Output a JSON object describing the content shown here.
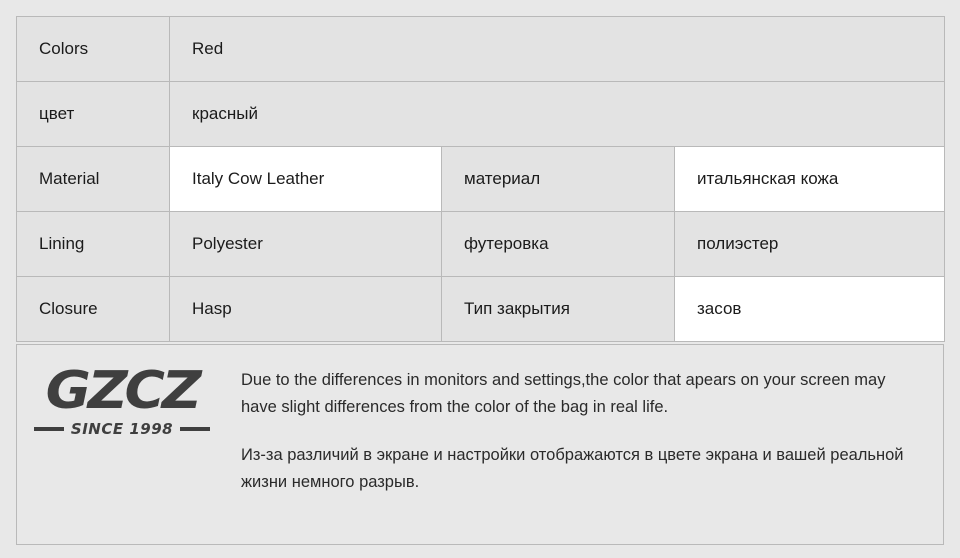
{
  "spec_table": {
    "rows": [
      {
        "name": "colors-en",
        "cells": [
          {
            "text": "Colors",
            "white": false,
            "span": 1,
            "lang": "en"
          },
          {
            "text": "Red",
            "white": false,
            "span": 3,
            "lang": "en"
          }
        ]
      },
      {
        "name": "colors-ru",
        "cells": [
          {
            "text": "цвет",
            "white": false,
            "span": 1,
            "lang": "ru"
          },
          {
            "text": "красный",
            "white": false,
            "span": 3,
            "lang": "ru"
          }
        ]
      },
      {
        "name": "material",
        "cells": [
          {
            "text": "Material",
            "white": false,
            "span": 1,
            "lang": "en"
          },
          {
            "text": "Italy Cow Leather",
            "white": true,
            "span": 1,
            "lang": "en"
          },
          {
            "text": "материал",
            "white": false,
            "span": 1,
            "lang": "ru"
          },
          {
            "text": "итальянская кожа",
            "white": true,
            "span": 1,
            "lang": "ru"
          }
        ]
      },
      {
        "name": "lining",
        "cells": [
          {
            "text": "Lining",
            "white": false,
            "span": 1,
            "lang": "en"
          },
          {
            "text": "Polyester",
            "white": false,
            "span": 1,
            "lang": "en"
          },
          {
            "text": "футеровка",
            "white": false,
            "span": 1,
            "lang": "ru"
          },
          {
            "text": "полиэстер",
            "white": false,
            "span": 1,
            "lang": "ru"
          }
        ]
      },
      {
        "name": "closure",
        "cells": [
          {
            "text": "Closure",
            "white": false,
            "span": 1,
            "lang": "en"
          },
          {
            "text": "Hasp",
            "white": false,
            "span": 1,
            "lang": "en"
          },
          {
            "text": "Тип закрытия",
            "white": false,
            "span": 1,
            "lang": "ru"
          },
          {
            "text": "засов",
            "white": true,
            "span": 1,
            "lang": "ru"
          }
        ]
      }
    ]
  },
  "footer": {
    "logo": {
      "brand": "GZCZ",
      "since": "SINCE 1998"
    },
    "notices": [
      "Due to the differences in monitors and settings,the color that apears on your screen may have slight differences from the color of the bag in real life.",
      "Из-за различий в экране и настройки отображаются в цвете экрана и вашей реальной жизни немного разрыв."
    ]
  },
  "colors": {
    "page_background": "#e8e8e8",
    "cell_gray": "#e3e3e3",
    "cell_white": "#ffffff",
    "border": "#b9b9b9",
    "text": "#1b1b1b",
    "logo": "#3f3f3f"
  }
}
